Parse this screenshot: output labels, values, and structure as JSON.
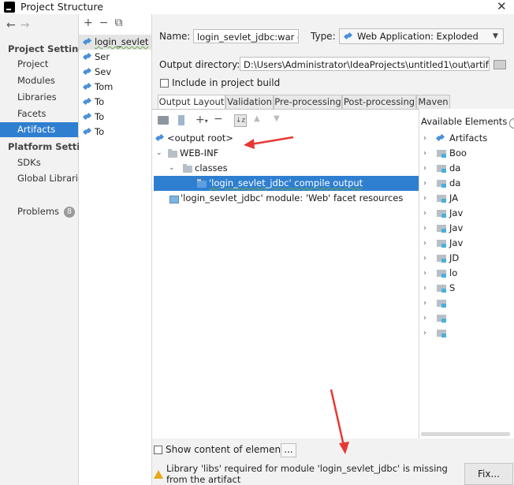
{
  "window": {
    "title": "Project Structure",
    "close": "✕"
  },
  "nav": {
    "back": "←",
    "forward": "→",
    "project_settings_heading": "Project Settings",
    "project_settings": [
      "Project",
      "Modules",
      "Libraries",
      "Facets",
      "Artifacts"
    ],
    "platform_heading": "Platform Setting",
    "platform": [
      "SDKs",
      "Global Librarie"
    ],
    "problems": "Problems",
    "problems_count": "8"
  },
  "artifacts_list": {
    "add": "+",
    "remove": "−",
    "copy": "⧉",
    "items": [
      "login_sevlet",
      "Ser",
      "Sev",
      "Tom",
      "To",
      "To",
      "To"
    ]
  },
  "config": {
    "name_label": "Name:",
    "name_value": "login_sevlet_jdbc:war e:",
    "type_label": "Type:",
    "type_value": "Web Application: Exploded",
    "output_dir_label": "Output directory:",
    "output_dir_value": "D:\\Users\\Administrator\\IdeaProjects\\untitled1\\out\\artifacts\\",
    "include_build": "Include in project build"
  },
  "tabs": [
    "Output Layout",
    "Validation",
    "Pre-processing",
    "Post-processing",
    "Maven"
  ],
  "layout_tree": {
    "output_root": "<output root>",
    "web_inf": "WEB-INF",
    "classes": "classes",
    "compile_output": "'login_sevlet_jdbc' compile output",
    "facet_resources": "'login_sevlet_jdbc' module: 'Web' facet resources"
  },
  "available": {
    "heading": "Available Elements",
    "help": "?",
    "items": [
      "Artifacts",
      "Boo",
      "da",
      "da",
      "JA",
      "Jav",
      "Jav",
      "Jav",
      "JD",
      "lo",
      "S",
      "",
      "",
      ""
    ]
  },
  "bottom": {
    "show_content": "Show content of elements",
    "dots": "...",
    "warning": "Library 'libs' required for module 'login_sevlet_jdbc' is missing from the artifact",
    "fix": "Fix..."
  },
  "colors": {
    "selection": "#2f7fd1",
    "arrow": "#e53935",
    "warning": "#e6a817"
  }
}
